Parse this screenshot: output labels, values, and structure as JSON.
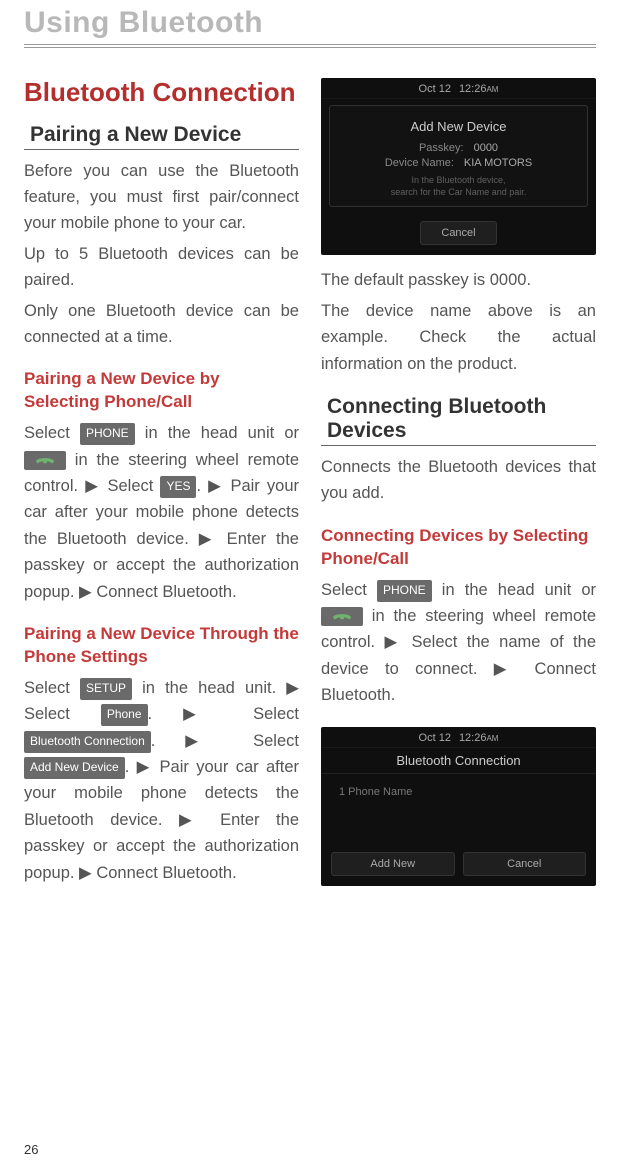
{
  "page": {
    "title": "Using Bluetooth",
    "number": "26"
  },
  "section": {
    "heading": "Bluetooth Connection"
  },
  "pairing": {
    "heading": "Pairing a New Device",
    "intro": "Before you can use the Bluetooth feature, you must first pair/connect your mobile phone to your car.",
    "limit": "Up to 5 Bluetooth devices can be paired.",
    "single": "Only one Bluetooth device can be connected at a time."
  },
  "pair_phonecall": {
    "heading": "Pairing a New Device by Selecting Phone/Call",
    "t1": "Select ",
    "t2": " in the head unit or ",
    "t3": " in the steering wheel remote control. ▶ Select ",
    "t4": ". ▶ Pair your car after your mobile phone detects the Bluetooth device. ▶ Enter the passkey or accept the authorization popup. ▶ Connect Bluetooth."
  },
  "pair_settings": {
    "heading": "Pairing a New Device Through the Phone Settings",
    "t1": "Select ",
    "t2": " in the head unit. ▶ Select  ",
    "t3": ". ▶ Select ",
    "t4": ". ▶ Select ",
    "t5": ". ▶ Pair your car after your mobile phone detects the Bluetooth device. ▶ Enter the passkey or accept the authorization popup. ▶ Connect Bluetooth."
  },
  "chips": {
    "phone": "PHONE",
    "yes": "YES",
    "setup": "SETUP",
    "phone2": "Phone",
    "bt_conn": "Bluetooth Connection",
    "add_new": "Add New Device"
  },
  "ss1": {
    "date": "Oct 12",
    "time": "12:26",
    "ampm": "AM",
    "title": "Add New Device",
    "passkey_label": "Passkey:",
    "passkey_value": "0000",
    "devname_label": "Device Name:",
    "devname_value": "KIA MOTORS",
    "hint1": "In the Bluetooth device,",
    "hint2": "search for the Car Name and pair.",
    "cancel": "Cancel"
  },
  "after_ss1": {
    "line1": "The default passkey is 0000.",
    "line2": "The device name above is an example. Check the actual information on the product."
  },
  "connecting": {
    "heading": "Connecting Bluetooth Devices",
    "intro": "Connects the Bluetooth devices that you add."
  },
  "conn_phonecall": {
    "heading": "Connecting Devices by Selecting Phone/Call",
    "t1": "Select ",
    "t2": " in the head unit or ",
    "t3": " in the steering wheel remote control. ▶ Select the name of the device to connect. ▶ Connect Bluetooth."
  },
  "ss2": {
    "date": "Oct 12",
    "time": "12:26",
    "ampm": "AM",
    "title": "Bluetooth Connection",
    "item1": "1  Phone Name",
    "addnew": "Add New",
    "cancel": "Cancel"
  }
}
